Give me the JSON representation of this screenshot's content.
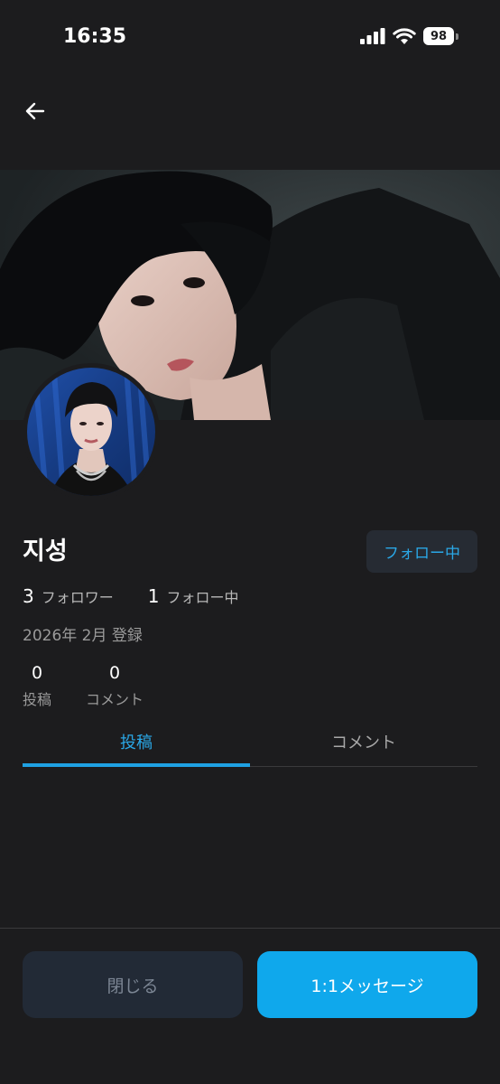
{
  "status_bar": {
    "time": "16:35",
    "battery": "98",
    "icons": [
      "cellular-signal-icon",
      "wifi-icon",
      "battery-icon"
    ]
  },
  "header": {
    "back_icon": "arrow-left-icon"
  },
  "profile": {
    "name": "지성",
    "follow_button": "フォロー中",
    "followers_count": "3",
    "followers_label": "フォロワー",
    "following_count": "1",
    "following_label": "フォロー中",
    "joined": "2026年 2月 登録",
    "posts_count": "0",
    "posts_label": "投稿",
    "comments_count": "0",
    "comments_label": "コメント"
  },
  "tabs": [
    {
      "label": "投稿",
      "active": true
    },
    {
      "label": "コメント",
      "active": false
    }
  ],
  "footer": {
    "close_label": "閉じる",
    "message_label": "1:1メッセージ"
  },
  "colors": {
    "background": "#1c1c1e",
    "accent": "#1fa1e3",
    "primary_button": "#0fa8ec",
    "secondary_button": "#222a36"
  }
}
